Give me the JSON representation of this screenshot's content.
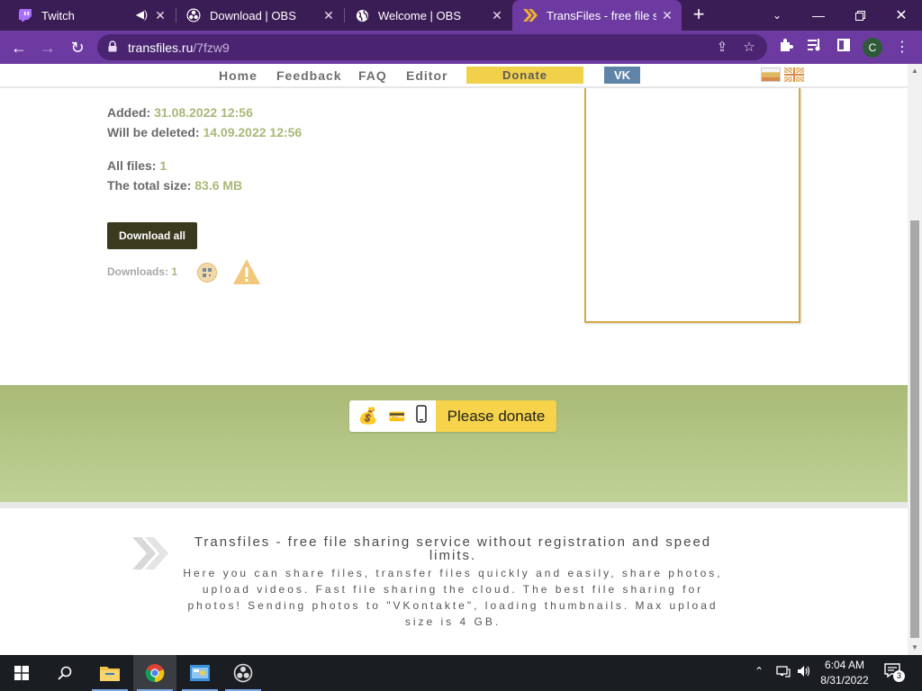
{
  "browser": {
    "tabs": [
      {
        "title": "Twitch",
        "icon": "twitch-icon"
      },
      {
        "title": "Download | OBS",
        "icon": "obs-icon"
      },
      {
        "title": "Welcome | OBS",
        "icon": "globe-icon"
      },
      {
        "title": "TransFiles - free file sha",
        "icon": "transfiles-icon"
      }
    ],
    "url_host": "transfiles.ru",
    "url_path": "/7fzw9",
    "profile_initial": "C"
  },
  "site_nav": {
    "home": "Home",
    "feedback": "Feedback",
    "faq": "FAQ",
    "editor": "Editor",
    "donate": "Donate",
    "vk": "VK"
  },
  "file_info": {
    "added_label": "Added:",
    "added_value": "31.08.2022 12:56",
    "deleted_label": "Will be deleted:",
    "deleted_value": "14.09.2022 12:56",
    "all_files_label": "All files:",
    "all_files_value": "1",
    "total_size_label": "The total size:",
    "total_size_value": "83.6 MB",
    "download_all": "Download all",
    "downloads_label": "Downloads:",
    "downloads_value": "1"
  },
  "donate_banner": {
    "label": "Please donate"
  },
  "footer": {
    "headline": "Transfiles - free file sharing service without registration and speed limits.",
    "description": "Here you can share files, transfer files quickly and easily, share photos, upload videos. Fast file sharing the cloud. The best file sharing for photos! Sending photos to \"VKontakte\", loading thumbnails. Max upload size is 4 GB."
  },
  "taskbar": {
    "time": "6:04 AM",
    "date": "8/31/2022",
    "notifications": "3"
  },
  "colors": {
    "browser_frame": "#3b1d55",
    "browser_toolbar": "#6c3aa0",
    "accent_yellow": "#f2d14a",
    "value_green": "#a8b878",
    "banner_green": "#a9ba76"
  }
}
